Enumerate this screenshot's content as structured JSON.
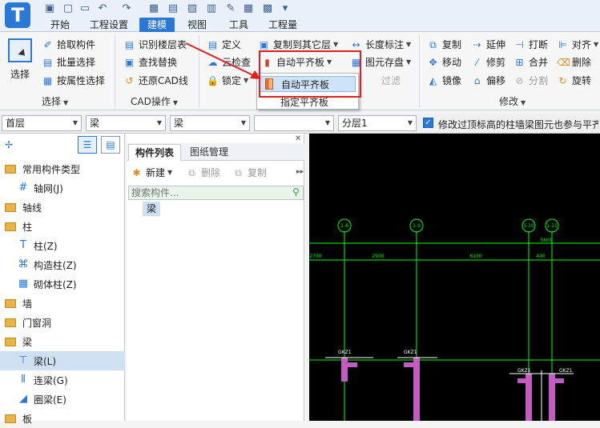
{
  "app": {
    "logo_letter": "T"
  },
  "tabs": [
    {
      "label": "开始"
    },
    {
      "label": "工程设置"
    },
    {
      "label": "建模"
    },
    {
      "label": "视图"
    },
    {
      "label": "工具"
    },
    {
      "label": "工程量"
    }
  ],
  "ribbon": {
    "select_group": {
      "big_button": "选择",
      "pick": "拾取构件",
      "batch": "批量选择",
      "by_attr": "按属性选择",
      "label": "选择"
    },
    "cad_group": {
      "identify_floor": "识别楼层表",
      "find_replace": "查找替换",
      "restore_cad": "还原CAD线",
      "label": "CAD操作"
    },
    "general_group": {
      "define": "定义",
      "cloud_check": "云检查",
      "lock": "锁定",
      "copy_to_floor": "复制到其它层",
      "auto_flush": "自动平齐板",
      "length_mark": "长度标注",
      "element_save": "图元存盘",
      "filter_partial": "过滤"
    },
    "modify_group": {
      "copy": "复制",
      "extend": "延伸",
      "break": "打断",
      "align": "对齐",
      "move": "移动",
      "trim": "修剪",
      "merge": "合并",
      "delete": "删除",
      "mirror": "镜像",
      "offset": "偏移",
      "split": "分割",
      "rotate": "旋转",
      "label": "修改"
    }
  },
  "dropdown": {
    "items": [
      "自动平齐板",
      "指定平齐板"
    ]
  },
  "filterbar": {
    "floor": "首层",
    "category": "梁",
    "type": "梁",
    "component": "",
    "layer": "分层1",
    "checkbox_label": "修改过顶标高的柱墙梁图元也参与平齐"
  },
  "tree": {
    "items": [
      "常用构件类型",
      "轴网(J)",
      "轴线",
      "柱",
      "柱(Z)",
      "构造柱(Z)",
      "砌体柱(Z)",
      "墙",
      "门窗洞",
      "梁",
      "梁(L)",
      "连梁(G)",
      "圈梁(E)",
      "板"
    ]
  },
  "component_panel": {
    "tabs": [
      "构件列表",
      "图纸管理"
    ],
    "new_label": "新建",
    "delete_label": "删除",
    "copy_label": "复制",
    "search_placeholder": "搜索构件...",
    "items": [
      "梁"
    ]
  },
  "drawing": {
    "axis_labels": [
      "1-8",
      "1-9",
      "1-10",
      "1-11"
    ],
    "dims_top": [
      "2700",
      "2900",
      "6100",
      "400"
    ],
    "dim_right": "5601",
    "beam_labels": [
      "GKZ1",
      "GKZ1",
      "GKZ1",
      "GKZ1"
    ],
    "accent": "#00ff00"
  }
}
